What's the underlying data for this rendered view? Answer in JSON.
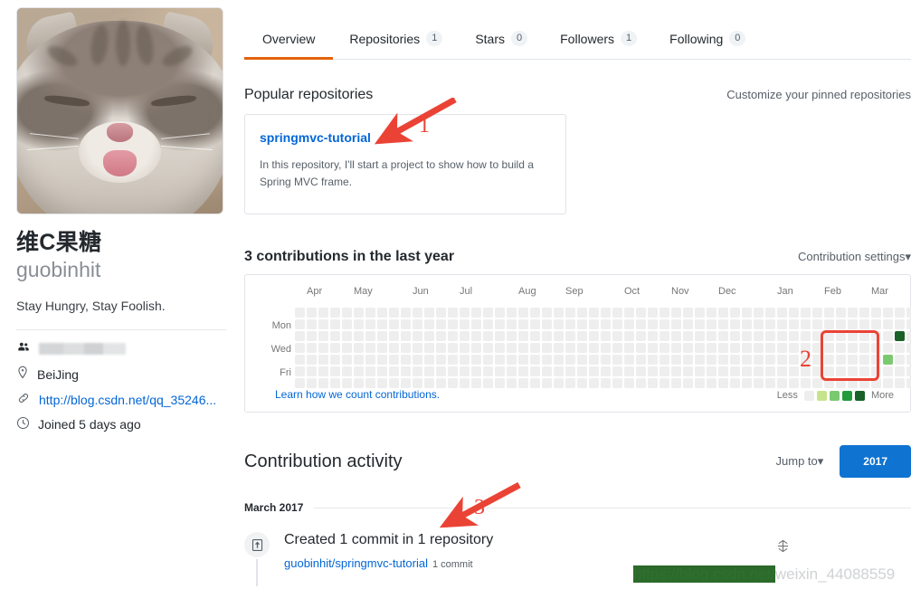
{
  "profile": {
    "avatar_alt": "cat-avatar",
    "full_name": "维C果糖",
    "username": "guobinhit",
    "bio": "Stay Hungry, Stay Foolish.",
    "organization_redacted": "",
    "location": "BeiJing",
    "website": "http://blog.csdn.net/qq_35246...",
    "joined": "Joined 5 days ago"
  },
  "tabs": [
    {
      "label": "Overview",
      "count": null,
      "active": true
    },
    {
      "label": "Repositories",
      "count": "1",
      "active": false
    },
    {
      "label": "Stars",
      "count": "0",
      "active": false
    },
    {
      "label": "Followers",
      "count": "1",
      "active": false
    },
    {
      "label": "Following",
      "count": "0",
      "active": false
    }
  ],
  "popular": {
    "title": "Popular repositories",
    "customize_link": "Customize your pinned repositories",
    "repos": [
      {
        "name": "springmvc-tutorial",
        "description": "In this repository, I'll start a project to show how to build a Spring MVC frame."
      }
    ]
  },
  "contributions": {
    "title": "3 contributions in the last year",
    "settings_label": "Contribution settings",
    "settings_caret": "▾",
    "learn_link": "Learn how we count contributions.",
    "legend_less": "Less",
    "legend_more": "More",
    "months": [
      "Apr",
      "May",
      "Jun",
      "Jul",
      "Aug",
      "Sep",
      "Oct",
      "Nov",
      "Dec",
      "Jan",
      "Feb",
      "Mar"
    ],
    "day_labels": [
      "Mon",
      "Wed",
      "Fri"
    ],
    "legend_colors": [
      "#eeeeee",
      "#c6e48b",
      "#7bc96f",
      "#239a3b",
      "#196127"
    ],
    "empty_color": "#eeeeee",
    "weeks": 53,
    "rows": 7,
    "active_cells": [
      {
        "week": 51,
        "row": 2,
        "color": "#196127",
        "count": 2
      },
      {
        "week": 50,
        "row": 4,
        "color": "#7bc96f",
        "count": 1
      }
    ]
  },
  "activity": {
    "title": "Contribution activity",
    "jump_to": "Jump to",
    "jump_caret": "▾",
    "year_button": "2017",
    "month_heading": "March 2017",
    "entries": [
      {
        "icon": "commit-icon",
        "title": "Created 1 commit in 1 repository",
        "repo": "guobinhit/springmvc-tutorial",
        "commit_count": "1 commit"
      }
    ]
  },
  "annotations": [
    {
      "number": "1",
      "color": "#ea4335"
    },
    {
      "number": "2",
      "color": "#ea4335"
    },
    {
      "number": "3",
      "color": "#ea4335"
    }
  ],
  "watermark": {
    "highlighted": "https://blog.csdn.net/",
    "plain": "weixin_44088559"
  },
  "colors": {
    "accent_orange": "#e36209",
    "link_blue": "#0366d6",
    "button_blue": "#0f73d1",
    "annotation_red": "#ea4335"
  }
}
